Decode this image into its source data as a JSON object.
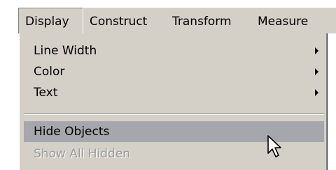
{
  "menubar": {
    "items": [
      {
        "label": "Display"
      },
      {
        "label": "Construct"
      },
      {
        "label": "Transform"
      },
      {
        "label": "Measure"
      }
    ]
  },
  "dropdown": {
    "items": [
      {
        "label": "Line Width",
        "has_submenu": true
      },
      {
        "label": "Color",
        "has_submenu": true
      },
      {
        "label": "Text",
        "has_submenu": true
      },
      {
        "label": "Hide Objects",
        "highlighted": true
      },
      {
        "label": "Show All Hidden",
        "disabled": true
      }
    ]
  },
  "colors": {
    "menu_face": "#d4d0c8",
    "highlight": "#a6a6ad",
    "disabled_text": "#9a9a9a"
  },
  "icons": {
    "cursor": "mouse-pointer-icon",
    "submenu": "submenu-arrow-icon"
  }
}
